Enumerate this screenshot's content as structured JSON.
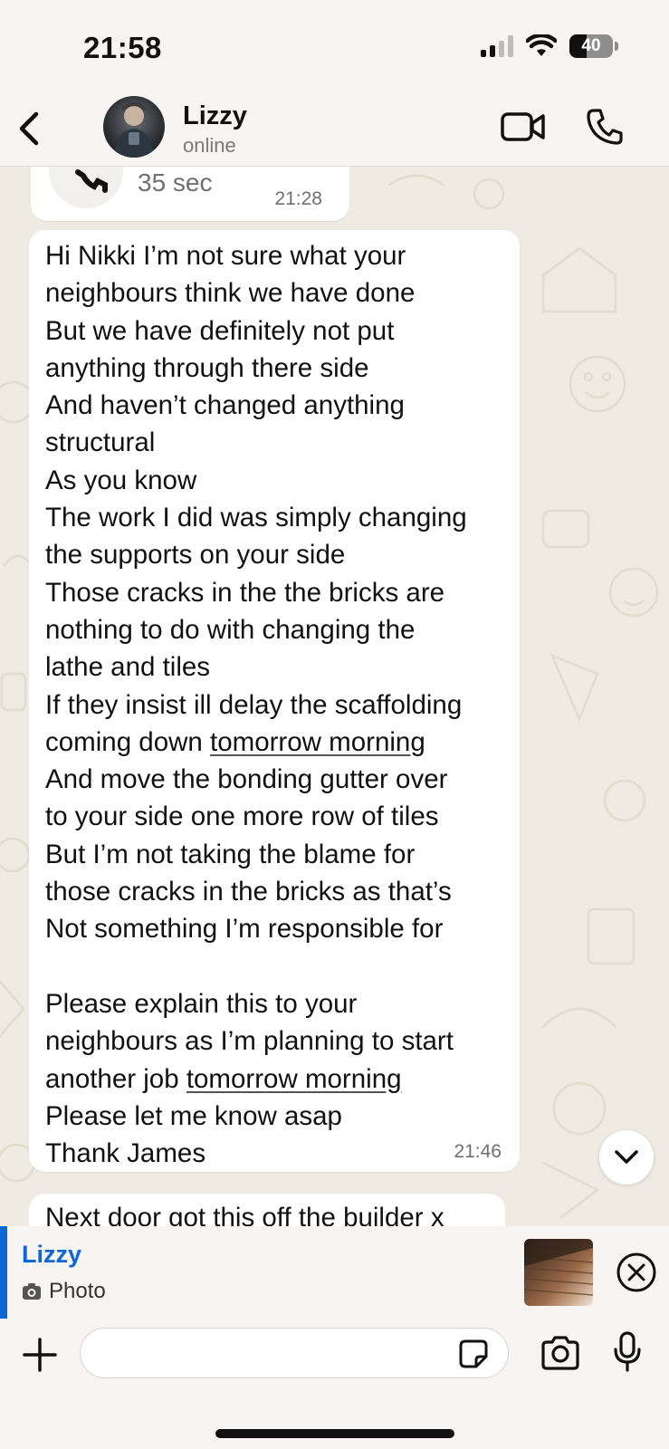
{
  "status_bar": {
    "time": "21:58",
    "battery_level": "40",
    "battery_fraction": 0.4,
    "icons": [
      "cellular-signal-icon",
      "wifi-icon",
      "battery-icon"
    ]
  },
  "header": {
    "contact_name": "Lizzy",
    "contact_status": "online",
    "icons": [
      "back-chevron-icon",
      "video-call-icon",
      "voice-call-icon"
    ]
  },
  "call_message": {
    "duration": "35 sec",
    "time": "21:28"
  },
  "message": {
    "lines": [
      "Hi Nikki I’m not sure what your",
      "neighbours think we have done",
      "But we have definitely not put",
      "anything through there side",
      "And haven’t changed anything",
      "structural",
      "As you know",
      "The work I did was simply changing",
      "the supports on your side",
      "Those cracks in the the bricks are",
      "nothing to do with changing the",
      "lathe and tiles",
      "If they insist ill delay the scaffolding",
      "coming down ",
      "And move the bonding gutter over",
      "to your side one more row of tiles",
      "But I’m not taking the blame for",
      "those cracks in the bricks as that’s",
      "Not something I’m responsible for",
      "",
      "Please explain this to your",
      "neighbours as I’m planning to start",
      "another job ",
      "Please let me know asap",
      "Thank James"
    ],
    "link_text": "tomorrow morning",
    "time": "21:46"
  },
  "next_message": {
    "text": "Next door got this off the builder x"
  },
  "reply_preview": {
    "name": "Lizzy",
    "type": "Photo",
    "accent_color": "#0b66d6"
  },
  "input": {
    "placeholder": ""
  }
}
